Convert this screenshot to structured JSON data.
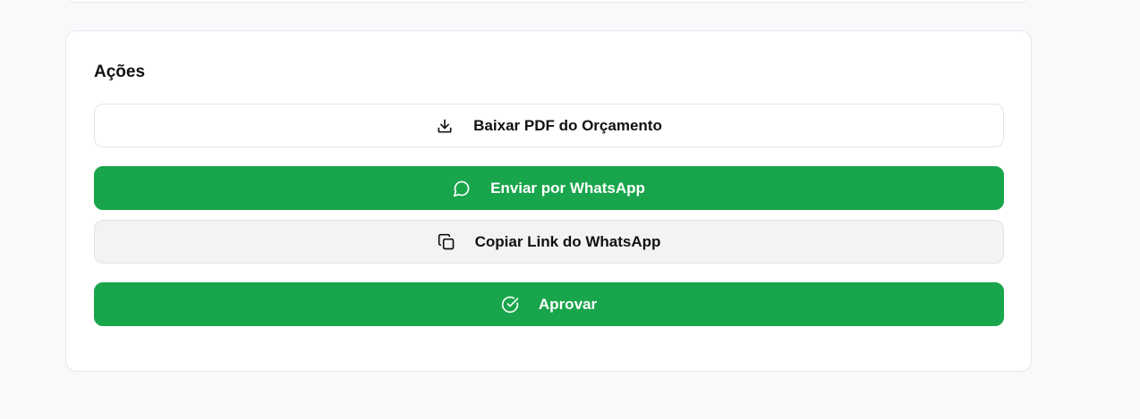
{
  "actions": {
    "title": "Ações",
    "buttons": [
      {
        "label": "Baixar PDF do Orçamento",
        "icon": "download-icon",
        "style": "outline"
      },
      {
        "label": "Enviar por WhatsApp",
        "icon": "message-circle-icon",
        "style": "green"
      },
      {
        "label": "Copiar Link do WhatsApp",
        "icon": "copy-icon",
        "style": "gray"
      },
      {
        "label": "Aprovar",
        "icon": "check-circle-icon",
        "style": "green"
      }
    ]
  },
  "colors": {
    "accent_green": "#19a54b",
    "page_background": "#f8f9fb",
    "card_background": "#ffffff",
    "secondary_button": "#f3f3f1"
  }
}
